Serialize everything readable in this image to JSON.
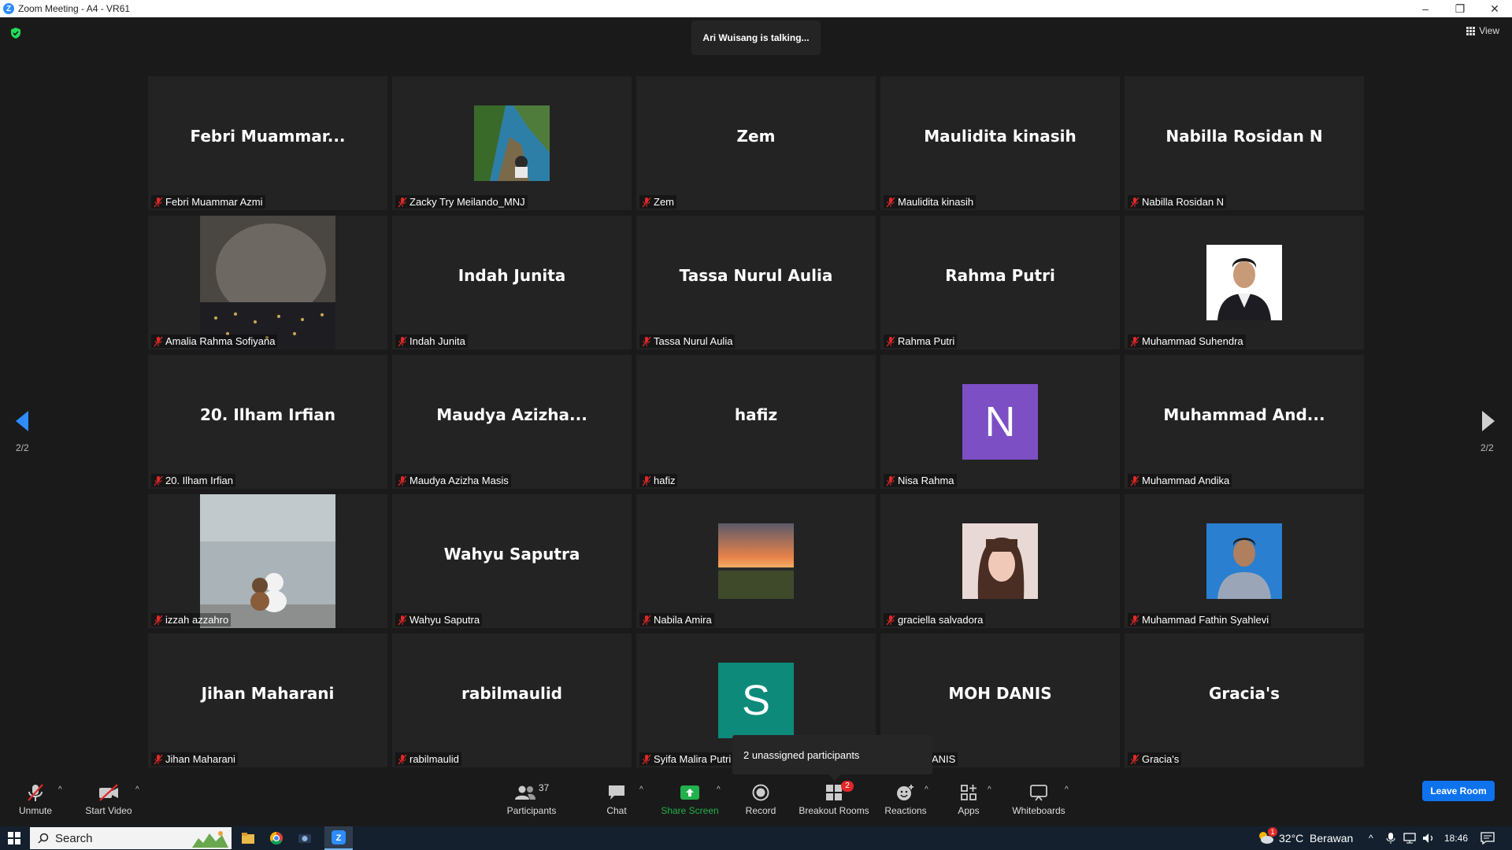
{
  "window": {
    "title": "Zoom Meeting - A4 - VR61",
    "logo_letter": "Z"
  },
  "meeting": {
    "talking": "Ari Wuisang is talking...",
    "view_label": "View",
    "page_left": "2/2",
    "page_right": "2/2",
    "tooltip": "2 unassigned participants"
  },
  "tiles": [
    {
      "big": "Febri  Muammar...",
      "label": "Febri Muammar Azmi"
    },
    {
      "big": "",
      "label": "Zacky Try Meilando_MNJ"
    },
    {
      "big": "Zem",
      "label": "Zem"
    },
    {
      "big": "Maulidita kinasih",
      "label": "Maulidita kinasih"
    },
    {
      "big": "Nabilla Rosidan N",
      "label": "Nabilla Rosidan N"
    },
    {
      "big": "",
      "label": "Amalia Rahma Sofiyana"
    },
    {
      "big": "Indah Junita",
      "label": "Indah Junita"
    },
    {
      "big": "Tassa Nurul Aulia",
      "label": "Tassa Nurul Aulia"
    },
    {
      "big": "Rahma Putri",
      "label": "Rahma Putri"
    },
    {
      "big": "",
      "label": "Muhammad Suhendra"
    },
    {
      "big": "20. Ilham Irfian",
      "label": "20. Ilham Irfian"
    },
    {
      "big": "Maudya  Azizha...",
      "label": "Maudya Azizha Masis"
    },
    {
      "big": "hafiz",
      "label": "hafiz"
    },
    {
      "big": "",
      "label": "Nisa Rahma",
      "letter": "N",
      "color": "#7c4fc4"
    },
    {
      "big": "Muhammad  And...",
      "label": "Muhammad Andika"
    },
    {
      "big": "",
      "label": "izzah azzahro"
    },
    {
      "big": "Wahyu Saputra",
      "label": "Wahyu Saputra"
    },
    {
      "big": "",
      "label": "Nabila Amira"
    },
    {
      "big": "",
      "label": "graciella salvadora"
    },
    {
      "big": "",
      "label": "Muhammad Fathin Syahlevi"
    },
    {
      "big": "Jihan Maharani",
      "label": "Jihan Maharani"
    },
    {
      "big": "rabilmaulid",
      "label": "rabilmaulid"
    },
    {
      "big": "",
      "label": "Syifa Malira Putri",
      "letter": "S",
      "color": "#0e8a7a"
    },
    {
      "big": "MOH DANIS",
      "label": "ANIS"
    },
    {
      "big": "Gracia's",
      "label": "Gracia's"
    }
  ],
  "toolbar": {
    "unmute": "Unmute",
    "start_video": "Start Video",
    "participants": "Participants",
    "participants_count": "37",
    "chat": "Chat",
    "share_screen": "Share Screen",
    "record": "Record",
    "breakout_rooms": "Breakout Rooms",
    "breakout_badge": "2",
    "reactions": "Reactions",
    "apps": "Apps",
    "whiteboards": "Whiteboards",
    "leave_room": "Leave Room",
    "share_color": "#22b14c",
    "leave_color": "#0e72ed"
  },
  "taskbar": {
    "search": "Search",
    "weather": "32°C  Berawan",
    "weather_badge": "1",
    "time": "18:46"
  }
}
